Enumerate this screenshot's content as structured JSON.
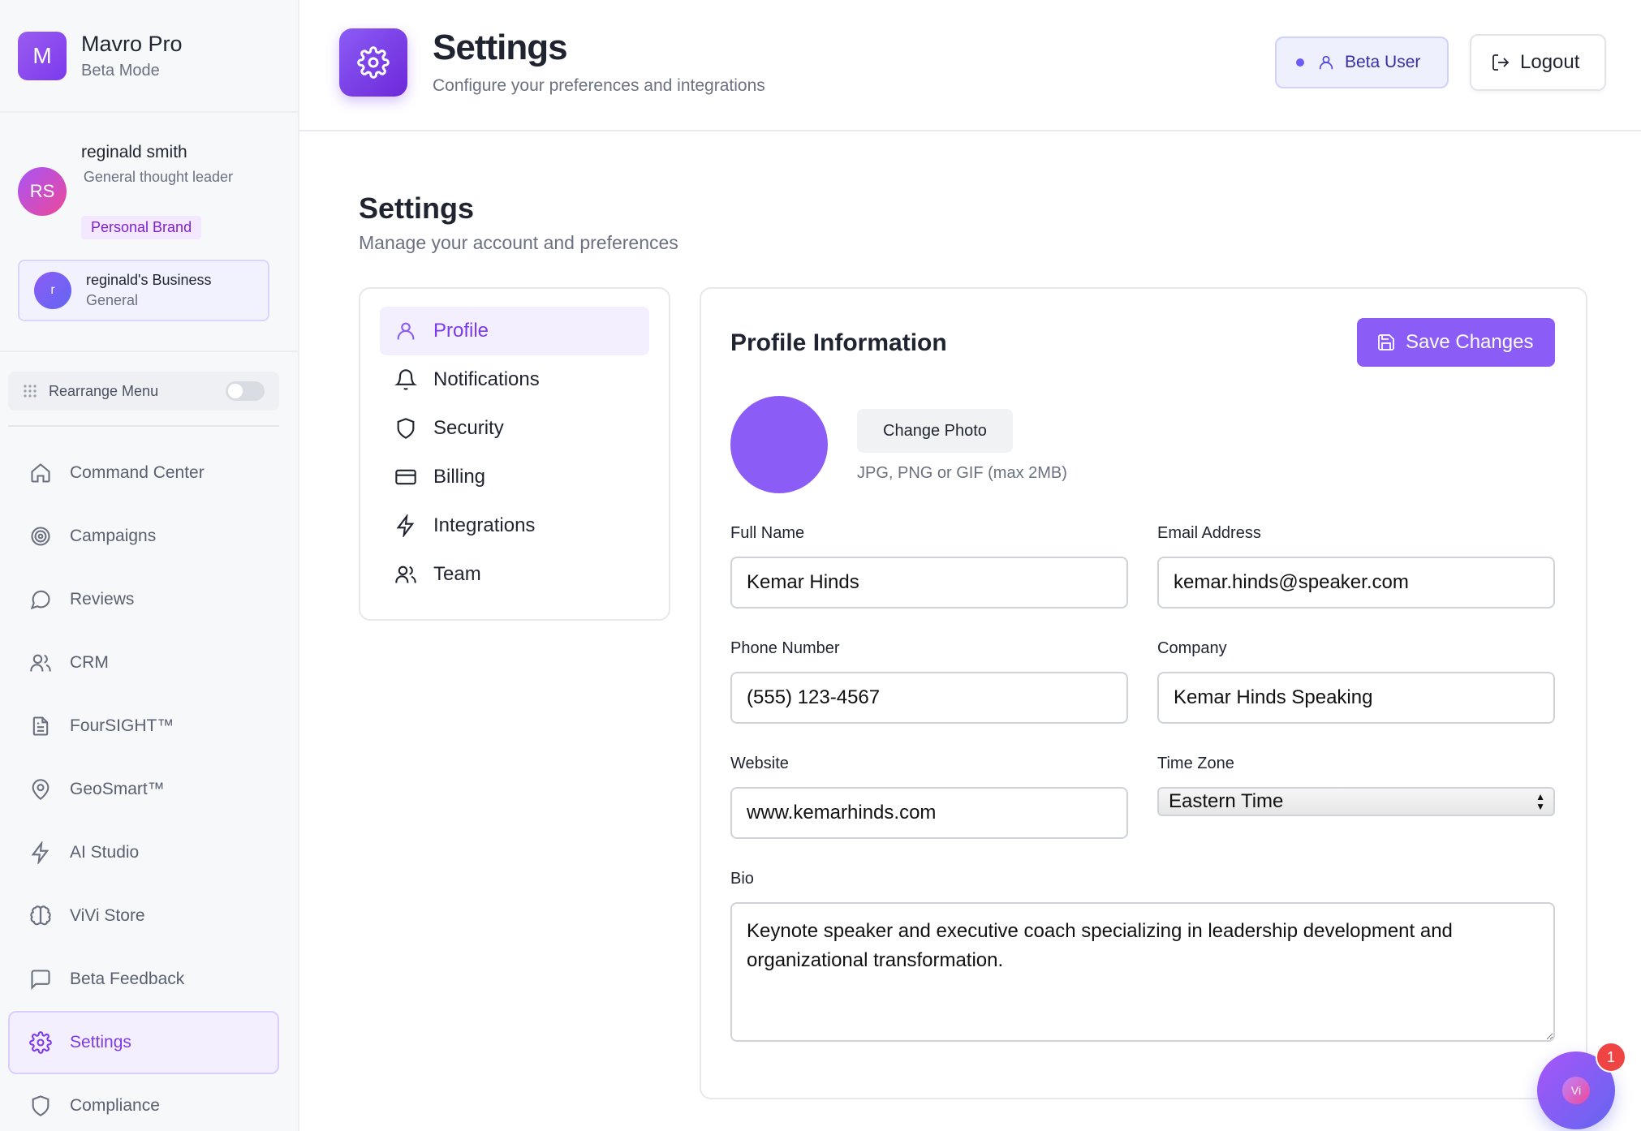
{
  "brand": {
    "logo_letter": "M",
    "name": "Mavro Pro",
    "mode": "Beta Mode"
  },
  "user": {
    "initials": "RS",
    "name": "reginald smith",
    "role": "General thought leader",
    "badge": "Personal Brand"
  },
  "business": {
    "initial": "r",
    "name": "reginald's Business",
    "category": "General"
  },
  "rearrange": {
    "label": "Rearrange Menu",
    "enabled": false
  },
  "nav": [
    {
      "label": "Command Center",
      "icon": "home-icon"
    },
    {
      "label": "Campaigns",
      "icon": "target-icon"
    },
    {
      "label": "Reviews",
      "icon": "chat-bubble-icon"
    },
    {
      "label": "CRM",
      "icon": "users-icon"
    },
    {
      "label": "FourSIGHT™",
      "icon": "document-icon"
    },
    {
      "label": "GeoSmart™",
      "icon": "map-pin-icon"
    },
    {
      "label": "AI Studio",
      "icon": "lightning-icon"
    },
    {
      "label": "ViVi Store",
      "icon": "brain-icon"
    },
    {
      "label": "Beta Feedback",
      "icon": "message-square-icon"
    },
    {
      "label": "Settings",
      "icon": "gear-icon",
      "active": true
    },
    {
      "label": "Compliance",
      "icon": "shield-icon"
    }
  ],
  "header": {
    "title": "Settings",
    "subtitle": "Configure your preferences and integrations",
    "beta_label": "Beta User",
    "logout_label": "Logout"
  },
  "page": {
    "title": "Settings",
    "subtitle": "Manage your account and preferences"
  },
  "tabs": [
    {
      "label": "Profile",
      "icon": "user-icon",
      "active": true
    },
    {
      "label": "Notifications",
      "icon": "bell-icon"
    },
    {
      "label": "Security",
      "icon": "shield-icon"
    },
    {
      "label": "Billing",
      "icon": "credit-card-icon"
    },
    {
      "label": "Integrations",
      "icon": "lightning-icon"
    },
    {
      "label": "Team",
      "icon": "users-icon"
    }
  ],
  "profile": {
    "title": "Profile Information",
    "save_label": "Save Changes",
    "change_photo_label": "Change Photo",
    "photo_hint": "JPG, PNG or GIF (max 2MB)",
    "full_name_label": "Full Name",
    "full_name": "Kemar Hinds",
    "email_label": "Email Address",
    "email": "kemar.hinds@speaker.com",
    "phone_label": "Phone Number",
    "phone": "(555) 123-4567",
    "company_label": "Company",
    "company": "Kemar Hinds Speaking",
    "website_label": "Website",
    "website": "www.kemarhinds.com",
    "timezone_label": "Time Zone",
    "timezone": "Eastern Time",
    "bio_label": "Bio",
    "bio": "Keynote speaker and executive coach specializing in leadership development and organizational transformation."
  },
  "chat": {
    "initials": "Vi",
    "badge_count": "1"
  },
  "colors": {
    "accent": "#8b5cf6",
    "accent_dark": "#7c3aed",
    "badge_red": "#ef4444"
  }
}
